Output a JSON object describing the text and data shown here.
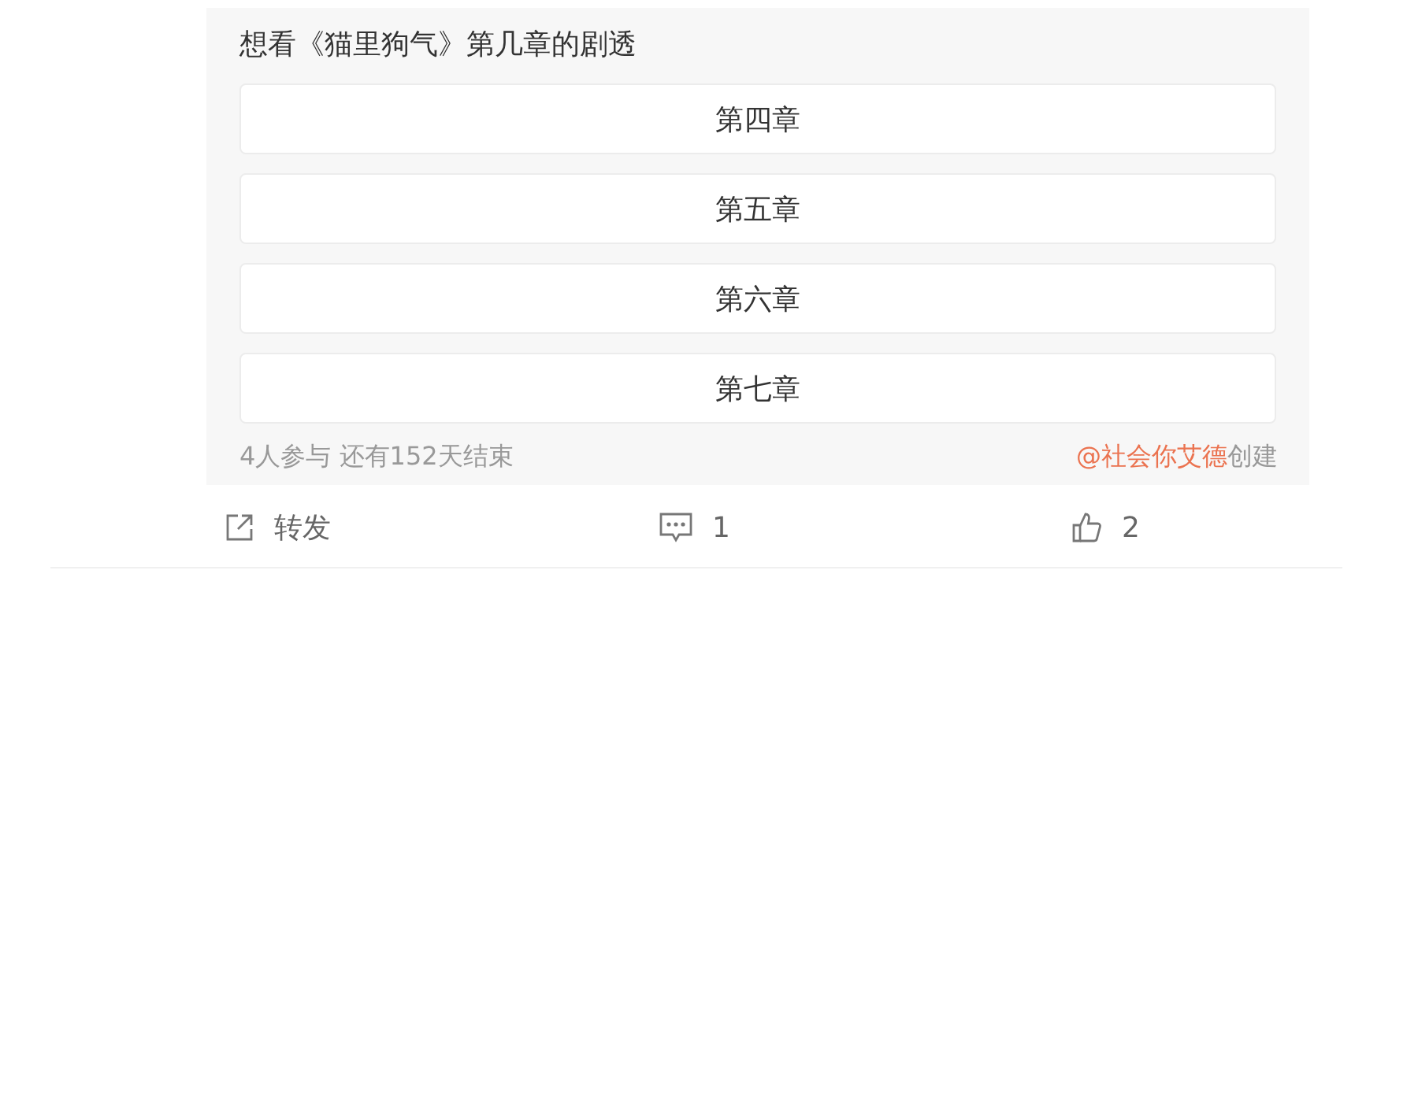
{
  "poll": {
    "title": "想看《猫里狗气》第几章的剧透",
    "options": [
      {
        "label": "第四章"
      },
      {
        "label": "第五章"
      },
      {
        "label": "第六章"
      },
      {
        "label": "第七章"
      }
    ],
    "stats": "4人参与 还有152天结束",
    "creator": {
      "handle": "@社会你艾德",
      "suffix": "创建"
    }
  },
  "actions": [
    {
      "kind": "share",
      "label": "转发"
    },
    {
      "kind": "comment",
      "label": "1"
    },
    {
      "kind": "like",
      "label": "2"
    }
  ]
}
